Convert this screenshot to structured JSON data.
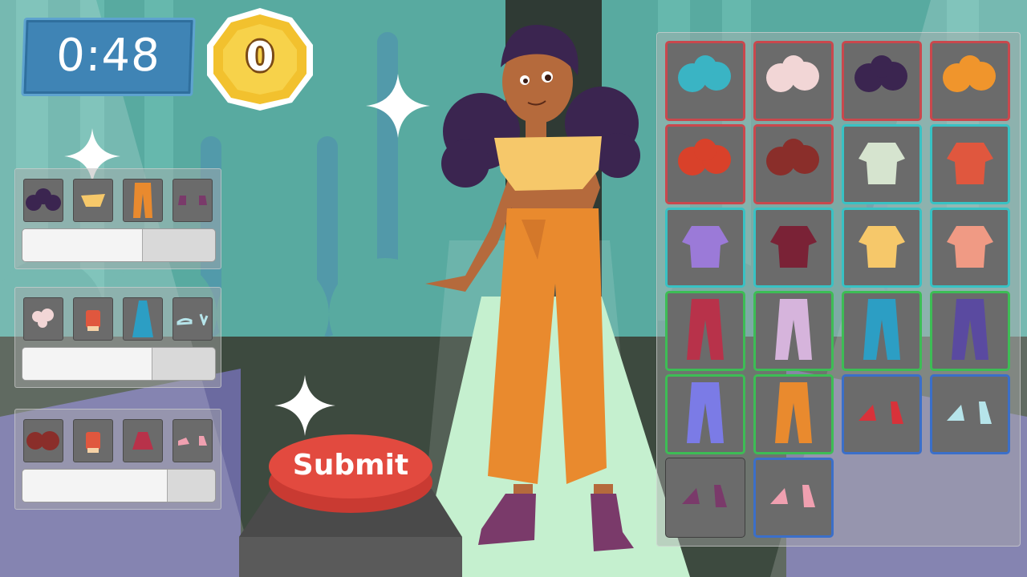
{
  "hud": {
    "timer": "0:48",
    "coins": "0"
  },
  "submit_label": "Submit",
  "orders": [
    {
      "items": [
        "dark-pigtails-hair",
        "yellow-crop-top",
        "orange-wide-pants",
        "purple-boots"
      ],
      "progress": 0.62
    },
    {
      "items": [
        "white-curly-hair",
        "red-bow-top",
        "teal-skirt",
        "cyan-flats"
      ],
      "progress": 0.67
    },
    {
      "items": [
        "maroon-curly-hair",
        "red-bow-top",
        "red-plaid-skirt",
        "pink-sneakers"
      ],
      "progress": 0.75
    }
  ],
  "wardrobe": [
    {
      "category": "hair",
      "item": "teal-ponytail-hair",
      "color": "#3ab4c4"
    },
    {
      "category": "hair",
      "item": "white-curly-hair",
      "color": "#f2d6d6"
    },
    {
      "category": "hair",
      "item": "dark-pigtails-hair",
      "color": "#3b2550"
    },
    {
      "category": "hair",
      "item": "orange-long-hair",
      "color": "#f0952c"
    },
    {
      "category": "hair",
      "item": "red-short-hair",
      "color": "#d9412a"
    },
    {
      "category": "hair",
      "item": "maroon-curly-hair",
      "color": "#8a2e2a"
    },
    {
      "category": "top",
      "item": "white-blazer-top",
      "color": "#d6e4cf"
    },
    {
      "category": "top",
      "item": "red-bow-top",
      "color": "#e0573e"
    },
    {
      "category": "top",
      "item": "purple-sweater-top",
      "color": "#9b7ad8"
    },
    {
      "category": "top",
      "item": "maroon-tank-top",
      "color": "#7a2236"
    },
    {
      "category": "top",
      "item": "yellow-crop-top",
      "color": "#f6c86a"
    },
    {
      "category": "top",
      "item": "peach-hoodie-top",
      "color": "#f09a84"
    },
    {
      "category": "bottom",
      "item": "red-plaid-skirt",
      "color": "#b8324a"
    },
    {
      "category": "bottom",
      "item": "lilac-jeans",
      "color": "#d6b4dc"
    },
    {
      "category": "bottom",
      "item": "teal-skirt",
      "color": "#2c9ec4"
    },
    {
      "category": "bottom",
      "item": "indigo-jeans",
      "color": "#5a4aa0"
    },
    {
      "category": "bottom",
      "item": "blue-mini-skirt",
      "color": "#7b7be6"
    },
    {
      "category": "bottom",
      "item": "orange-wide-pants",
      "color": "#e98a2e"
    },
    {
      "category": "shoes",
      "item": "red-heel-boots",
      "color": "#d8323a"
    },
    {
      "category": "shoes",
      "item": "cyan-flats",
      "color": "#b6e4ea"
    },
    {
      "category": "none",
      "item": "purple-boots",
      "color": "#7a3a6a"
    },
    {
      "category": "shoes",
      "item": "pink-sneakers",
      "color": "#f0a0b0"
    }
  ],
  "colors": {
    "background": "#4f9d92",
    "timer_box": "#3f84b5",
    "coin": "#f2c12e",
    "submit_button": "#e24a3f",
    "runway": "#c5f0cf"
  }
}
